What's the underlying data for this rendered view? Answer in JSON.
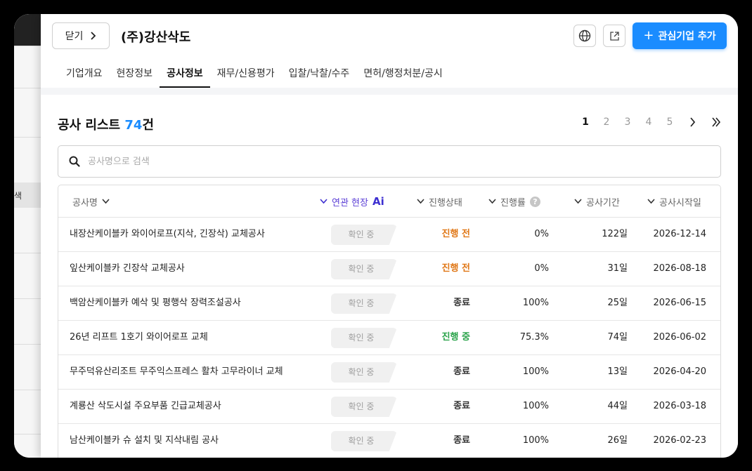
{
  "header": {
    "close_label": "닫기",
    "company_name": "(주)강산삭도",
    "add_button_label": "관심기업 추가"
  },
  "tabs": [
    {
      "label": "기업개요",
      "active": false
    },
    {
      "label": "현장정보",
      "active": false
    },
    {
      "label": "공사정보",
      "active": true
    },
    {
      "label": "재무/신용평가",
      "active": false
    },
    {
      "label": "입찰/낙찰/수주",
      "active": false
    },
    {
      "label": "면허/행정처분/공시",
      "active": false
    }
  ],
  "list": {
    "title": "공사 리스트",
    "count": "74",
    "count_suffix": "건"
  },
  "pager": {
    "pages": [
      "1",
      "2",
      "3",
      "4",
      "5"
    ],
    "current": "1"
  },
  "search": {
    "placeholder": "공사명으로 검색"
  },
  "table": {
    "columns": {
      "name": "공사명",
      "related": "연관 현장",
      "related_badge": "Ai",
      "status": "진행상태",
      "rate": "진행률",
      "rate_help": "?",
      "period": "공사기간",
      "start": "공사시작일"
    },
    "rows": [
      {
        "name": "내장산케이블카 와이어로프(지삭, 긴장삭) 교체공사",
        "related": "확인 중",
        "status": "진행 전",
        "status_type": "before",
        "rate": "0%",
        "period": "122일",
        "start": "2026-12-14"
      },
      {
        "name": "잎산케이블카 긴장삭 교체공사",
        "related": "확인 중",
        "status": "진행 전",
        "status_type": "before",
        "rate": "0%",
        "period": "31일",
        "start": "2026-08-18"
      },
      {
        "name": "백암산케이블카 예삭 및 평행삭 장력조설공사",
        "related": "확인 중",
        "status": "종료",
        "status_type": "done",
        "rate": "100%",
        "period": "25일",
        "start": "2026-06-15"
      },
      {
        "name": "26년 리프트 1호기 와이어로프 교체",
        "related": "확인 중",
        "status": "진행 중",
        "status_type": "ongoing",
        "rate": "75.3%",
        "period": "74일",
        "start": "2026-06-02"
      },
      {
        "name": "무주덕유산리조트 무주익스프레스 활차 고무라이너 교체",
        "related": "확인 중",
        "status": "종료",
        "status_type": "done",
        "rate": "100%",
        "period": "13일",
        "start": "2026-04-20"
      },
      {
        "name": "계룡산 삭도시설 주요부품 긴급교체공사",
        "related": "확인 중",
        "status": "종료",
        "status_type": "done",
        "rate": "100%",
        "period": "44일",
        "start": "2026-03-18"
      },
      {
        "name": "남산케이블카 슈 설치 및 지삭내림 공사",
        "related": "확인 중",
        "status": "종료",
        "status_type": "done",
        "rate": "100%",
        "period": "26일",
        "start": "2026-02-23"
      }
    ]
  },
  "background": {
    "selected_item_fragment": "색"
  },
  "colors": {
    "accent": "#1a8cff",
    "ai_purple": "#5b3fd6",
    "status_before": "#e07818",
    "status_ongoing": "#2aa34a",
    "status_done": "#333333"
  }
}
